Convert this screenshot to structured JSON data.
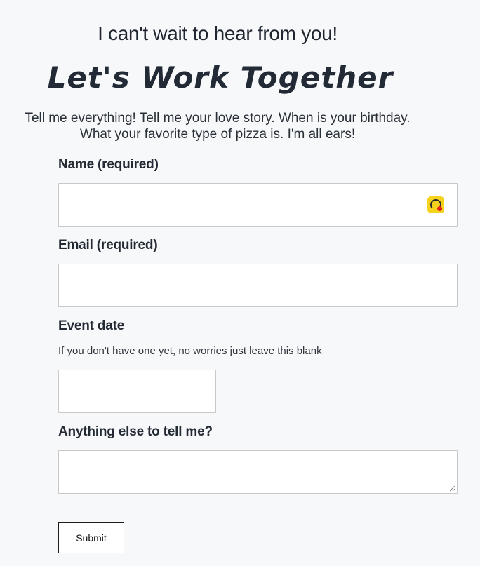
{
  "header": {
    "subtitle": "I can't wait to hear from you!",
    "headline": "Let's Work Together",
    "intro_line1": "Tell me everything! Tell me your love story. When is your birthday.",
    "intro_line2": "What your favorite type of pizza is. I'm all ears!"
  },
  "form": {
    "name": {
      "label": "Name (required)",
      "value": "",
      "extension_icon": "password-manager-icon"
    },
    "email": {
      "label": "Email (required)",
      "value": ""
    },
    "event_date": {
      "label": "Event date",
      "hint": "If you don't have one yet, no worries just leave this blank",
      "value": ""
    },
    "message": {
      "label": "Anything else to tell me?",
      "value": ""
    },
    "submit_label": "Submit"
  },
  "colors": {
    "background": "#f7f8fa",
    "text": "#222a33",
    "field_border": "#c9c9c9",
    "extension_icon_bg": "#f5d21c",
    "extension_icon_dot": "#e2231a"
  }
}
